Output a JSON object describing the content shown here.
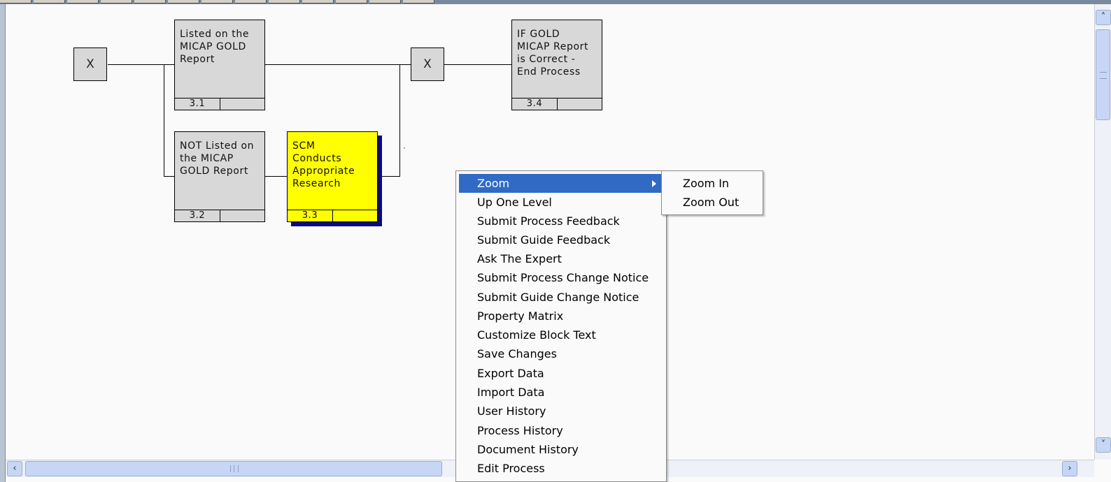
{
  "diagram": {
    "junctions": [
      {
        "label": "X"
      },
      {
        "label": "X"
      }
    ],
    "blocks": [
      {
        "number": "3.1",
        "text": "Listed on the\nMICAP GOLD\nReport"
      },
      {
        "number": "3.2",
        "text": "NOT Listed on\nthe MICAP\nGOLD Report"
      },
      {
        "number": "3.3",
        "text": "SCM\nConducts\nAppropriate\nResearch"
      },
      {
        "number": "3.4",
        "text": "IF GOLD\nMICAP Report\nis Correct -\nEnd Process"
      }
    ],
    "colors": {
      "highlight": "#ffff00",
      "shadow": "#0a0a80",
      "block": "#d8d8d8"
    }
  },
  "context_menu": {
    "items": [
      {
        "label": "Zoom",
        "has_submenu": true,
        "selected": true
      },
      {
        "label": "Up One Level"
      },
      {
        "label": "Submit Process Feedback"
      },
      {
        "label": "Submit Guide Feedback"
      },
      {
        "label": "Ask The Expert"
      },
      {
        "label": "Submit Process Change Notice"
      },
      {
        "label": "Submit Guide Change Notice"
      },
      {
        "label": "Property Matrix"
      },
      {
        "label": "Customize Block Text"
      },
      {
        "label": "Save Changes"
      },
      {
        "label": "Export Data"
      },
      {
        "label": "Import Data"
      },
      {
        "label": "User History"
      },
      {
        "label": "Process History"
      },
      {
        "label": "Document History"
      },
      {
        "label": "Edit Process"
      }
    ],
    "selection_color": "#316ac5"
  },
  "zoom_submenu": {
    "items": [
      {
        "label": "Zoom In"
      },
      {
        "label": "Zoom Out"
      }
    ]
  },
  "scrollbars": {
    "up": "chevron-up-icon",
    "down": "chevron-down-icon",
    "left": "chevron-left-icon",
    "right": "chevron-right-icon"
  }
}
